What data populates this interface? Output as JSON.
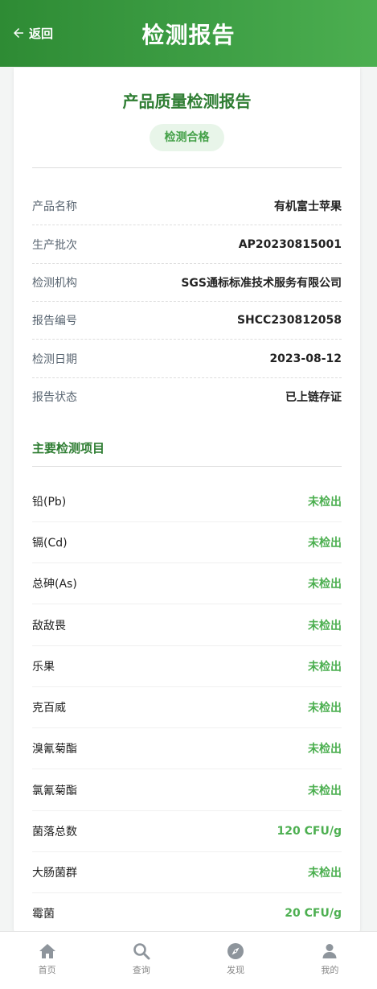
{
  "header": {
    "back_label": "返回",
    "title": "检测报告"
  },
  "report": {
    "title": "产品质量检测报告",
    "badge": "检测合格",
    "info": [
      {
        "label": "产品名称",
        "value": "有机富士苹果"
      },
      {
        "label": "生产批次",
        "value": "AP20230815001"
      },
      {
        "label": "检测机构",
        "value": "SGS通标标准技术服务有限公司"
      },
      {
        "label": "报告编号",
        "value": "SHCC230812058"
      },
      {
        "label": "检测日期",
        "value": "2023-08-12"
      },
      {
        "label": "报告状态",
        "value": "已上链存证"
      }
    ],
    "section_title": "主要检测项目",
    "tests": [
      {
        "name": "铅(Pb)",
        "result": "未检出"
      },
      {
        "name": "镉(Cd)",
        "result": "未检出"
      },
      {
        "name": "总砷(As)",
        "result": "未检出"
      },
      {
        "name": "敌敌畏",
        "result": "未检出"
      },
      {
        "name": "乐果",
        "result": "未检出"
      },
      {
        "name": "克百威",
        "result": "未检出"
      },
      {
        "name": "溴氰菊酯",
        "result": "未检出"
      },
      {
        "name": "氯氰菊酯",
        "result": "未检出"
      },
      {
        "name": "菌落总数",
        "result": "120 CFU/g"
      },
      {
        "name": "大肠菌群",
        "result": "未检出"
      },
      {
        "name": "霉菌",
        "result": "20 CFU/g"
      }
    ]
  },
  "tabbar": [
    {
      "label": "首页",
      "icon": "home-icon"
    },
    {
      "label": "查询",
      "icon": "search-icon"
    },
    {
      "label": "发现",
      "icon": "compass-icon"
    },
    {
      "label": "我的",
      "icon": "user-icon"
    }
  ],
  "colors": {
    "primary": "#2e7d32",
    "accent": "#4caf50",
    "icon_gray": "#8e959c"
  }
}
